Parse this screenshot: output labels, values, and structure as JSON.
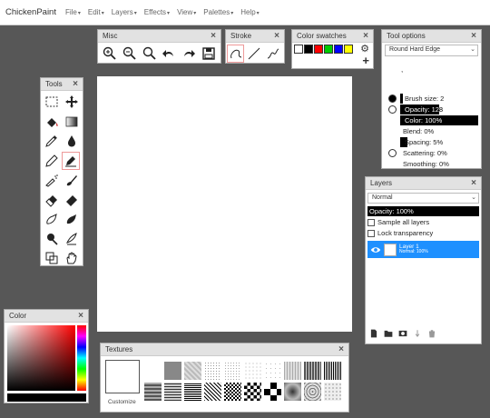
{
  "app": {
    "brand": "ChickenPaint",
    "menus": [
      "File",
      "Edit",
      "Layers",
      "Effects",
      "View",
      "Palettes",
      "Help"
    ]
  },
  "misc": {
    "title": "Misc",
    "close": "×"
  },
  "stroke": {
    "title": "Stroke",
    "close": "×"
  },
  "swatches": {
    "title": "Color swatches",
    "close": "×",
    "colors": [
      "#ffffff",
      "#000000",
      "#ff0000",
      "#00cc00",
      "#0000ff",
      "#ffff00"
    ],
    "add": "+"
  },
  "tool_options": {
    "title": "Tool options",
    "close": "×",
    "brush_type": "Round Hard Edge",
    "brush_size_label": "Brush size: 2",
    "opacity_label": "Opacity: 128",
    "color_label": "Color: 100%",
    "blend_label": "Blend: 0%",
    "spacing_label": "Spacing: 5%",
    "scattering_label": "Scattering: 0%",
    "smoothing_label": "Smoothing: 0%",
    "opacity_fraction": 0.5,
    "color_fraction": 1.0,
    "spacing_fraction": 0.05
  },
  "tools": {
    "title": "Tools",
    "close": "×"
  },
  "layers": {
    "title": "Layers",
    "close": "×",
    "blend_mode": "Normal",
    "opacity_label": "Opacity: 100%",
    "sample_all": "Sample all layers",
    "lock_transparency": "Lock transparency",
    "items": [
      {
        "name": "Layer 1",
        "mode": "Normal: 100%"
      }
    ]
  },
  "color": {
    "title": "Color",
    "close": "×",
    "hue_color": "#ff0000"
  },
  "textures": {
    "title": "Textures",
    "close": "×",
    "customize": "Customize"
  }
}
